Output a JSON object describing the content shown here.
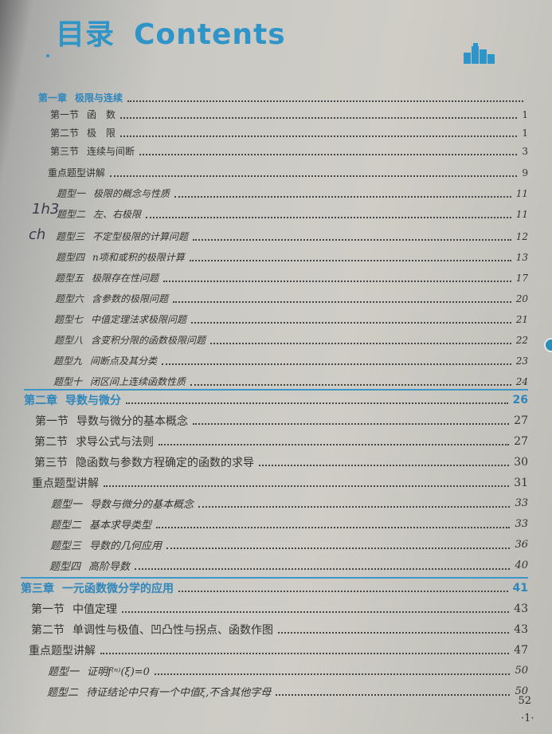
{
  "header": {
    "title_cn": "目录",
    "title_en": "Contents"
  },
  "toc": [
    {
      "kind": "chapter",
      "num": "第一章",
      "title": "极限与连续",
      "page": ""
    },
    {
      "kind": "section",
      "num": "第一节",
      "title": "函　数",
      "page": "1"
    },
    {
      "kind": "section",
      "num": "第二节",
      "title": "极　限",
      "page": "1"
    },
    {
      "kind": "section",
      "num": "第三节",
      "title": "连续与间断",
      "page": "3"
    },
    {
      "kind": "keypoint",
      "num": "",
      "title": "重点题型讲解",
      "page": "9"
    },
    {
      "kind": "qtype",
      "num": "题型一",
      "title": "极限的概念与性质",
      "page": "11"
    },
    {
      "kind": "qtype",
      "num": "题型二",
      "title": "左、右极限",
      "page": "11"
    },
    {
      "kind": "qtype",
      "num": "题型三",
      "title": "不定型极限的计算问题",
      "page": "12"
    },
    {
      "kind": "qtype",
      "num": "题型四",
      "title": "n项和或积的极限计算",
      "page": "13"
    },
    {
      "kind": "qtype",
      "num": "题型五",
      "title": "极限存在性问题",
      "page": "17"
    },
    {
      "kind": "qtype",
      "num": "题型六",
      "title": "含参数的极限问题",
      "page": "20"
    },
    {
      "kind": "qtype",
      "num": "题型七",
      "title": "中值定理法求极限问题",
      "page": "21"
    },
    {
      "kind": "qtype",
      "num": "题型八",
      "title": "含变积分限的函数极限问题",
      "page": "22"
    },
    {
      "kind": "qtype",
      "num": "题型九",
      "title": "间断点及其分类",
      "page": "23"
    },
    {
      "kind": "qtype",
      "num": "题型十",
      "title": "闭区间上连续函数性质",
      "page": "24"
    },
    {
      "kind": "chapter",
      "num": "第二章",
      "title": "导数与微分",
      "page": "26"
    },
    {
      "kind": "section",
      "num": "第一节",
      "title": "导数与微分的基本概念",
      "page": "27"
    },
    {
      "kind": "section",
      "num": "第二节",
      "title": "求导公式与法则",
      "page": "27"
    },
    {
      "kind": "section",
      "num": "第三节",
      "title": "隐函数与参数方程确定的函数的求导",
      "page": "30"
    },
    {
      "kind": "keypoint",
      "num": "",
      "title": "重点题型讲解",
      "page": "31"
    },
    {
      "kind": "qtype",
      "num": "题型一",
      "title": "导数与微分的基本概念",
      "page": "33"
    },
    {
      "kind": "qtype",
      "num": "题型二",
      "title": "基本求导类型",
      "page": "33"
    },
    {
      "kind": "qtype",
      "num": "题型三",
      "title": "导数的几何应用",
      "page": "36"
    },
    {
      "kind": "qtype",
      "num": "题型四",
      "title": "高阶导数",
      "page": "40"
    },
    {
      "kind": "chapter",
      "num": "第三章",
      "title": "一元函数微分学的应用",
      "page": "41"
    },
    {
      "kind": "section",
      "num": "第一节",
      "title": "中值定理",
      "page": "43"
    },
    {
      "kind": "section",
      "num": "第二节",
      "title": "单调性与极值、凹凸性与拐点、函数作图",
      "page": "43"
    },
    {
      "kind": "keypoint",
      "num": "",
      "title": "重点题型讲解",
      "page": "47"
    },
    {
      "kind": "qtype",
      "num": "题型一",
      "title": "证明f⁽ⁿ⁾(ξ)=0",
      "page": "50"
    },
    {
      "kind": "qtype",
      "num": "题型二",
      "title": "待证结论中只有一个中值ξ,不含其他字母",
      "page": "50"
    }
  ],
  "extra_page": "52",
  "footer": {
    "page_label": "·1·"
  },
  "handwriting": {
    "mark1": "1h3",
    "mark2": "ch"
  },
  "colors": {
    "accent": "#2f95c8",
    "chapter": "#2f86bb"
  },
  "icons": {
    "logo": "book-stack-logo-icon"
  }
}
